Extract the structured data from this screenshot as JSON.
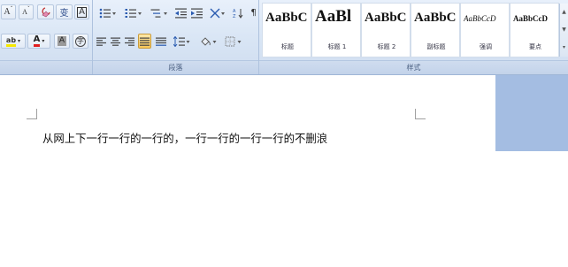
{
  "ribbon": {
    "font_group": {
      "grow_font_label": "A",
      "shrink_font_label": "A",
      "clear_format_icon": "eraser-icon",
      "phonetic_label": "变",
      "char_border_label": "A",
      "highlight_label": "ab",
      "font_color_label": "A",
      "char_shading_label": "A",
      "enclose_char_label": "字",
      "launcher": "⌐"
    },
    "paragraph_group": {
      "caption": "段落",
      "launcher": "⌐"
    },
    "styles_group": {
      "caption": "样式",
      "items": [
        {
          "sample": "AaBbC",
          "name": "标题"
        },
        {
          "sample": "AaBl",
          "name": "标题 1"
        },
        {
          "sample": "AaBbC",
          "name": "标题 2"
        },
        {
          "sample": "AaBbC",
          "name": "副标题"
        },
        {
          "sample": "AaBbCcD",
          "name": "强调"
        },
        {
          "sample": "AaBbCcD",
          "name": "要点"
        }
      ]
    }
  },
  "document": {
    "text": "从网上下一行一行的一行的，一行一行的一行一行的不删浪"
  }
}
